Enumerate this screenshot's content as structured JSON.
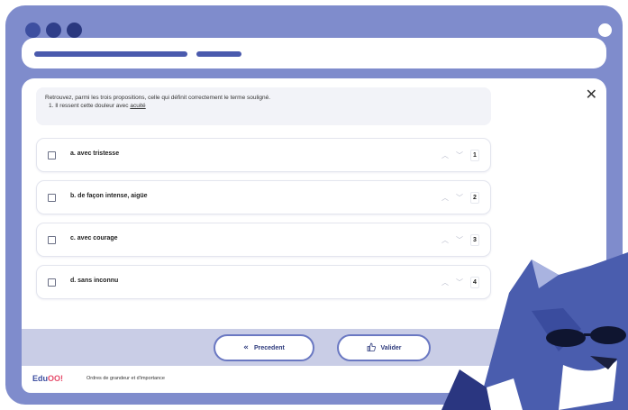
{
  "question": {
    "instruction": "Retrouvez, parmi les trois propositions, celle qui définit correctement le terme souligné.",
    "sentence_prefix": "1. Il ressent cette douleur avec ",
    "sentence_term": "acuité"
  },
  "options": [
    {
      "label": "a. avec tristesse",
      "rank": "1"
    },
    {
      "label": "b. de façon intense, aigüe",
      "rank": "2"
    },
    {
      "label": "c. avec courage",
      "rank": "3"
    },
    {
      "label": "d. sans inconnu",
      "rank": "4"
    }
  ],
  "icons": {
    "close": "close-icon",
    "up": "chevron-up-icon",
    "down": "chevron-down-icon",
    "prev": "double-chevron-left-icon",
    "validate": "thumbs-up-icon"
  },
  "footer": {
    "prev_label": "Precedent",
    "validate_label": "Valider"
  },
  "bottom": {
    "logo_prefix": "Edu",
    "logo_suffix": "OO!",
    "label": "Ordres de grandeur et d'importance"
  },
  "colors": {
    "window": "#7f8ccc",
    "accent": "#3d4fa0",
    "footer": "#c9cde6"
  }
}
